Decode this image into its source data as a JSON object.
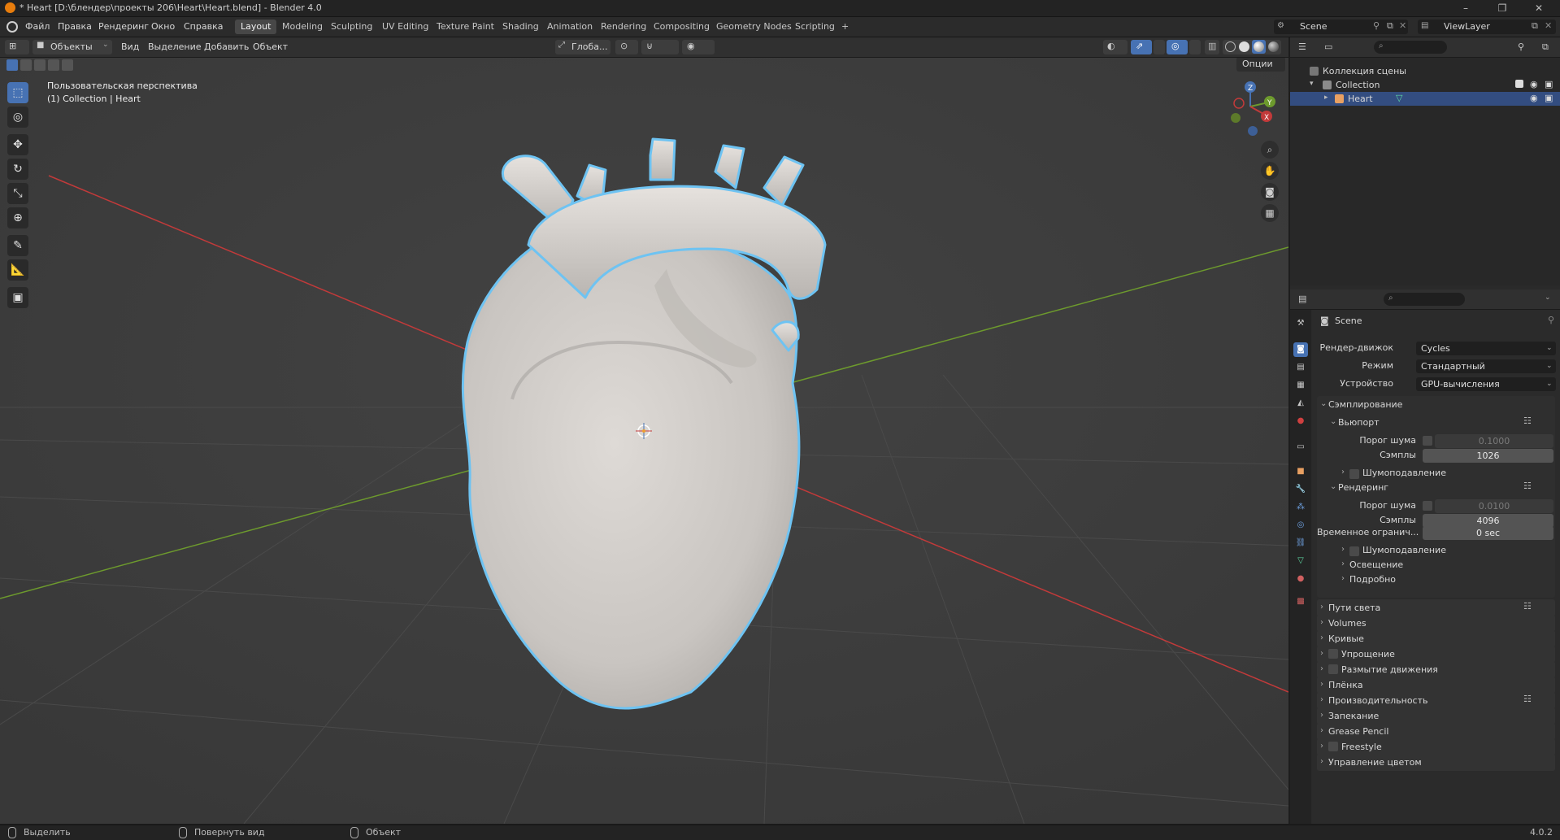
{
  "window": {
    "title": "* Heart [D:\\блендер\\проекты 206\\Heart\\Heart.blend] - Blender 4.0",
    "controls": [
      "–",
      "❐",
      "✕"
    ]
  },
  "menu": [
    "Файл",
    "Правка",
    "Рендеринг",
    "Окно",
    "Справка"
  ],
  "workspaces": [
    "Layout",
    "Modeling",
    "Sculpting",
    "UV Editing",
    "Texture Paint",
    "Shading",
    "Animation",
    "Rendering",
    "Compositing",
    "Geometry Nodes",
    "Scripting",
    "+"
  ],
  "active_workspace": "Layout",
  "scene_selector": {
    "label": "Scene"
  },
  "viewlayer_selector": {
    "label": "ViewLayer"
  },
  "viewport_header": {
    "mode": "Объекты",
    "menus": [
      "Вид",
      "Выделение",
      "Добавить",
      "Объект"
    ],
    "orientation": "Глоба...",
    "options": "Опции"
  },
  "viewport": {
    "perspective_label": "Пользовательская перспектива",
    "object_label": "(1) Collection | Heart",
    "gizmo_axes": [
      "X",
      "Y",
      "Z"
    ]
  },
  "tools": [
    {
      "name": "select-box-tool",
      "icon": "⬚",
      "active": true
    },
    {
      "name": "cursor-tool",
      "icon": "◎"
    },
    {
      "name": "move-tool",
      "icon": "✥"
    },
    {
      "name": "rotate-tool",
      "icon": "↻"
    },
    {
      "name": "scale-tool",
      "icon": "⤡"
    },
    {
      "name": "transform-tool",
      "icon": "⊕"
    },
    {
      "name": "annotate-tool",
      "icon": "✎"
    },
    {
      "name": "measure-tool",
      "icon": "📐"
    },
    {
      "name": "add-cube-tool",
      "icon": "▣"
    }
  ],
  "outliner": {
    "root": "Коллекция сцены",
    "collection": "Collection",
    "object": "Heart"
  },
  "properties": {
    "scene_name": "Scene",
    "render_engine_label": "Рендер-движок",
    "render_engine_value": "Cycles",
    "mode_label": "Режим",
    "mode_value": "Стандартный",
    "device_label": "Устройство",
    "device_value": "GPU-вычисления",
    "sampling": "Сэмплирование",
    "viewport": "Вьюпорт",
    "noise_threshold_label": "Порог шума",
    "viewport_noise_value": "0.1000",
    "samples_label": "Сэмплы",
    "viewport_samples": "1026",
    "denoise": "Шумоподавление",
    "render": "Рендеринг",
    "render_noise_value": "0.0100",
    "render_samples": "4096",
    "time_limit_label": "Временное огранич...",
    "time_limit_value": "0 sec",
    "lights": "Освещение",
    "advanced": "Подробно",
    "panels": [
      "Пути света",
      "Volumes",
      "Кривые",
      "Упрощение",
      "Размытие движения",
      "Плёнка",
      "Производительность",
      "Запекание",
      "Grease Pencil",
      "Freestyle",
      "Управление цветом"
    ]
  },
  "statusbar": {
    "select": "Выделить",
    "rotate_view": "Повернуть вид",
    "object": "Объект",
    "version": "4.0.2"
  },
  "colors": {
    "accent": "#4772b3",
    "selection_outline": "#6ec3f2",
    "x_axis": "#c23a3a",
    "y_axis": "#6d9a2d"
  }
}
